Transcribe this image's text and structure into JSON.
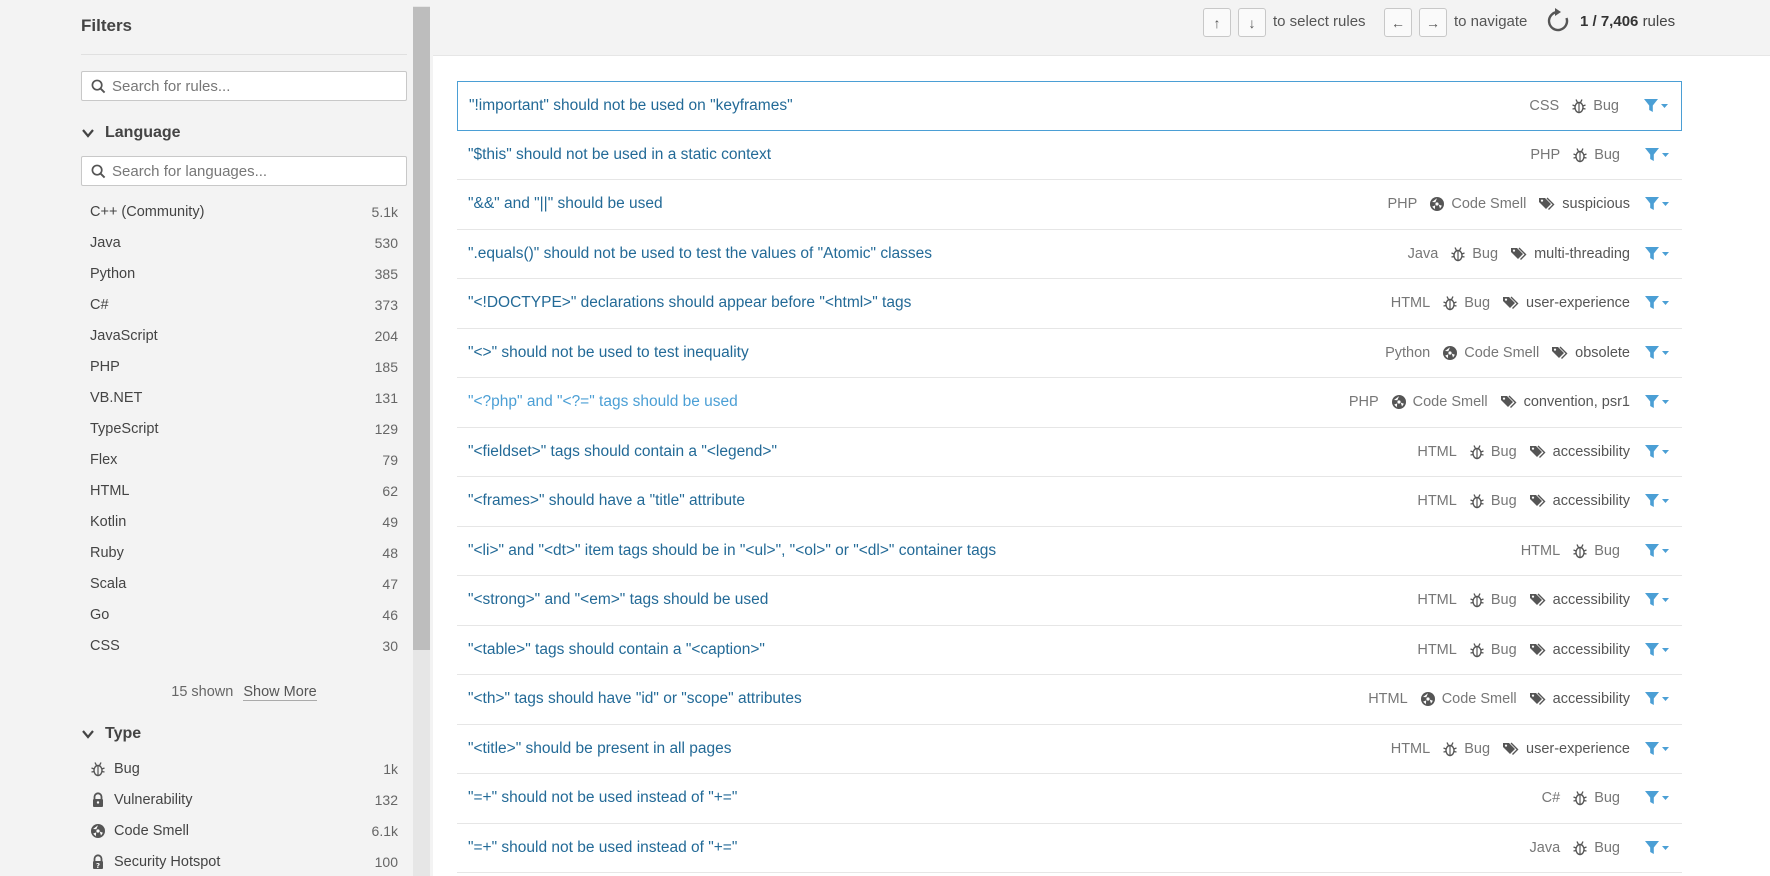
{
  "sidebar": {
    "title": "Filters",
    "rule_search_placeholder": "Search for rules...",
    "language": {
      "header": "Language",
      "search_placeholder": "Search for languages...",
      "items": [
        {
          "label": "C++ (Community)",
          "count": "5.1k"
        },
        {
          "label": "Java",
          "count": "530"
        },
        {
          "label": "Python",
          "count": "385"
        },
        {
          "label": "C#",
          "count": "373"
        },
        {
          "label": "JavaScript",
          "count": "204"
        },
        {
          "label": "PHP",
          "count": "185"
        },
        {
          "label": "VB.NET",
          "count": "131"
        },
        {
          "label": "TypeScript",
          "count": "129"
        },
        {
          "label": "Flex",
          "count": "79"
        },
        {
          "label": "HTML",
          "count": "62"
        },
        {
          "label": "Kotlin",
          "count": "49"
        },
        {
          "label": "Ruby",
          "count": "48"
        },
        {
          "label": "Scala",
          "count": "47"
        },
        {
          "label": "Go",
          "count": "46"
        },
        {
          "label": "CSS",
          "count": "30"
        }
      ],
      "shown_text": "15 shown",
      "show_more_label": "Show More"
    },
    "type": {
      "header": "Type",
      "items": [
        {
          "label": "Bug",
          "count": "1k",
          "icon": "bug-icon"
        },
        {
          "label": "Vulnerability",
          "count": "132",
          "icon": "lock-icon"
        },
        {
          "label": "Code Smell",
          "count": "6.1k",
          "icon": "code-smell-icon"
        },
        {
          "label": "Security Hotspot",
          "count": "100",
          "icon": "hotspot-icon"
        }
      ]
    }
  },
  "topbar": {
    "up_key": "↑",
    "down_key": "↓",
    "select_text": "to select rules",
    "left_key": "←",
    "right_key": "→",
    "navigate_text": "to navigate",
    "count_current": "1 / 7,406",
    "count_suffix": "rules"
  },
  "rules": [
    {
      "title": "\"!important\" should not be used on \"keyframes\"",
      "lang": "CSS",
      "type": "Bug",
      "tags": ""
    },
    {
      "title": "\"$this\" should not be used in a static context",
      "lang": "PHP",
      "type": "Bug",
      "tags": ""
    },
    {
      "title": "\"&&\" and \"||\" should be used",
      "lang": "PHP",
      "type": "Code Smell",
      "tags": "suspicious"
    },
    {
      "title": "\".equals()\" should not be used to test the values of \"Atomic\" classes",
      "lang": "Java",
      "type": "Bug",
      "tags": "multi-threading"
    },
    {
      "title": "\"<!DOCTYPE>\" declarations should appear before \"<html>\" tags",
      "lang": "HTML",
      "type": "Bug",
      "tags": "user-experience"
    },
    {
      "title": "\"<>\" should not be used to test inequality",
      "lang": "Python",
      "type": "Code Smell",
      "tags": "obsolete"
    },
    {
      "title": "\"<?php\" and \"<?=\" tags should be used",
      "lang": "PHP",
      "type": "Code Smell",
      "tags": "convention, psr1"
    },
    {
      "title": "\"<fieldset>\" tags should contain a \"<legend>\"",
      "lang": "HTML",
      "type": "Bug",
      "tags": "accessibility"
    },
    {
      "title": "\"<frames>\" should have a \"title\" attribute",
      "lang": "HTML",
      "type": "Bug",
      "tags": "accessibility"
    },
    {
      "title": "\"<li>\" and \"<dt>\" item tags should be in \"<ul>\", \"<ol>\" or \"<dl>\" container tags",
      "lang": "HTML",
      "type": "Bug",
      "tags": ""
    },
    {
      "title": "\"<strong>\" and \"<em>\" tags should be used",
      "lang": "HTML",
      "type": "Bug",
      "tags": "accessibility"
    },
    {
      "title": "\"<table>\" tags should contain a \"<caption>\"",
      "lang": "HTML",
      "type": "Bug",
      "tags": "accessibility"
    },
    {
      "title": "\"<th>\" tags should have \"id\" or \"scope\" attributes",
      "lang": "HTML",
      "type": "Code Smell",
      "tags": "accessibility"
    },
    {
      "title": "\"<title>\" should be present in all pages",
      "lang": "HTML",
      "type": "Bug",
      "tags": "user-experience"
    },
    {
      "title": "\"=+\" should not be used instead of \"+=\"",
      "lang": "C#",
      "type": "Bug",
      "tags": ""
    },
    {
      "title": "\"=+\" should not be used instead of \"+=\"",
      "lang": "Java",
      "type": "Bug",
      "tags": ""
    }
  ],
  "colors": {
    "accent": "#4b9fd5",
    "rule_link": "#236a97",
    "sidebar_bg": "#f3f3f3"
  }
}
